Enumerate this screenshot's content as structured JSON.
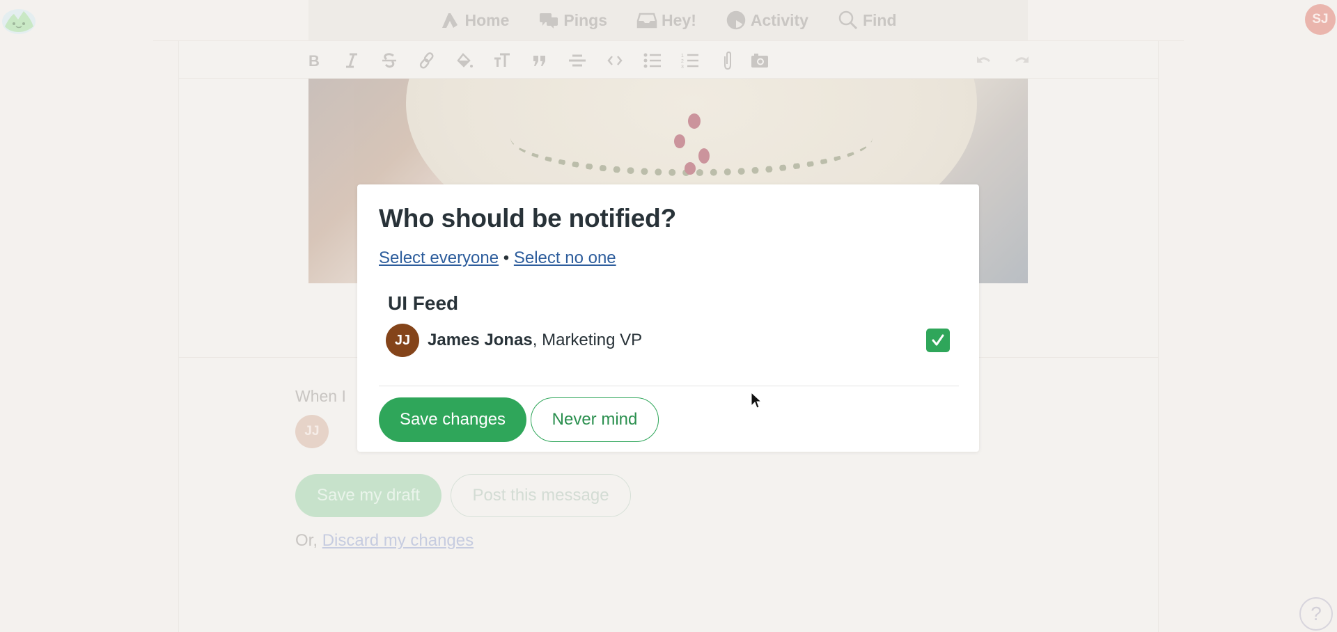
{
  "topnav": {
    "items": [
      {
        "label": "Home",
        "icon": "home-icon"
      },
      {
        "label": "Pings",
        "icon": "pings-icon"
      },
      {
        "label": "Hey!",
        "icon": "inbox-icon"
      },
      {
        "label": "Activity",
        "icon": "activity-icon"
      },
      {
        "label": "Find",
        "icon": "search-icon"
      }
    ],
    "user_initials": "SJ"
  },
  "toolbar": {
    "buttons": [
      {
        "name": "bold",
        "icon": "bold-icon"
      },
      {
        "name": "italic",
        "icon": "italic-icon"
      },
      {
        "name": "strikethrough",
        "icon": "strikethrough-icon"
      },
      {
        "name": "link",
        "icon": "link-icon"
      },
      {
        "name": "highlight",
        "icon": "paint-bucket-icon"
      },
      {
        "name": "heading",
        "icon": "text-size-icon"
      },
      {
        "name": "quote",
        "icon": "quote-icon"
      },
      {
        "name": "horizontal-rule",
        "icon": "horizontal-rule-icon"
      },
      {
        "name": "code",
        "icon": "code-icon"
      },
      {
        "name": "bullet-list",
        "icon": "bullet-list-icon"
      },
      {
        "name": "numbered-list",
        "icon": "numbered-list-icon"
      },
      {
        "name": "attach",
        "icon": "paperclip-icon"
      },
      {
        "name": "image",
        "icon": "camera-icon"
      }
    ],
    "undo_icon": "undo-icon",
    "redo_icon": "redo-icon"
  },
  "composer": {
    "when_text": "When I",
    "avatar_initials": "JJ",
    "save_draft_label": "Save my draft",
    "post_label": "Post this message",
    "or_text": "Or,",
    "discard_label": "Discard my changes"
  },
  "help": {
    "label": "?"
  },
  "modal": {
    "title": "Who should be notified?",
    "select_everyone": "Select everyone",
    "separator": "•",
    "select_no_one": "Select no one",
    "section_title": "UI Feed",
    "people": [
      {
        "initials": "JJ",
        "name": "James Jonas",
        "role": ", Marketing VP",
        "checked": true
      }
    ],
    "save_label": "Save changes",
    "cancel_label": "Never mind"
  },
  "colors": {
    "accent_green": "#2fa65a",
    "link_blue": "#2d5d9c",
    "avatar_brown": "#84441a",
    "user_avatar_pink": "#eab5ad"
  }
}
